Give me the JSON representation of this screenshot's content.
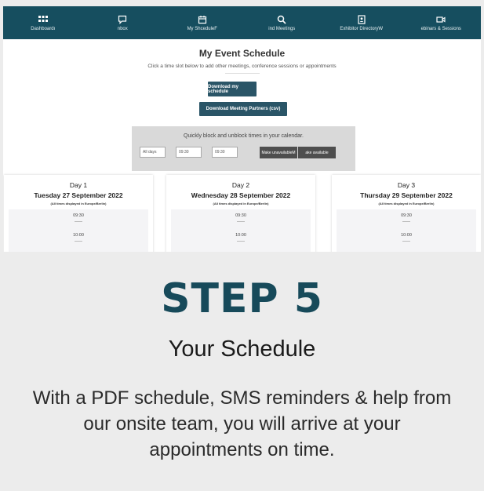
{
  "nav": {
    "items": [
      {
        "label": "Dashboardı",
        "icon": "grid-icon"
      },
      {
        "label": "nbox",
        "icon": "chat-icon"
      },
      {
        "label": "My ShceduleF",
        "icon": "calendar-icon"
      },
      {
        "label": "ind Meetings",
        "icon": "search-icon"
      },
      {
        "label": "Exhibitor DirectoryW",
        "icon": "contact-card-icon"
      },
      {
        "label": "ebinars & Sessions",
        "icon": "video-icon"
      }
    ]
  },
  "schedule": {
    "title": "My Event Schedule",
    "subtitle": "Click a time slot below to add other meetings, conference sessions or appointments",
    "download_schedule": "Download my schedule",
    "download_partners": "Download Meeting Partners (csv)"
  },
  "block": {
    "title": "Quickly block and unblock times in your calendar.",
    "day_select": "All days",
    "from_time": "09:30",
    "to_time": "09:30",
    "make_unavailable": "Make unavailableM",
    "make_available": "ake available"
  },
  "days": [
    {
      "label": "Day 1",
      "date": "Tuesday 27 September 2022",
      "tz": "(All times displayed in Europe/Berlin)",
      "slots": [
        "09:30",
        "10:00"
      ]
    },
    {
      "label": "Day 2",
      "date": "Wednesday 28 September 2022",
      "tz": "(All times displayed in Europe/Berlin)",
      "slots": [
        "09:30",
        "10:00"
      ]
    },
    {
      "label": "Day 3",
      "date": "Thursday 29 September 2022",
      "tz": "(All times displayed in Europe/Berlin)",
      "slots": [
        "09:30",
        "10:00"
      ]
    }
  ],
  "promo": {
    "step": "STEP 5",
    "title": "Your Schedule",
    "description": "With a PDF schedule, SMS reminders & help from our onsite team, you will arrive at your appointments on time."
  },
  "colors": {
    "nav_bg": "#164e5f",
    "button_bg": "#2a5567",
    "step_text": "#174a5a"
  }
}
